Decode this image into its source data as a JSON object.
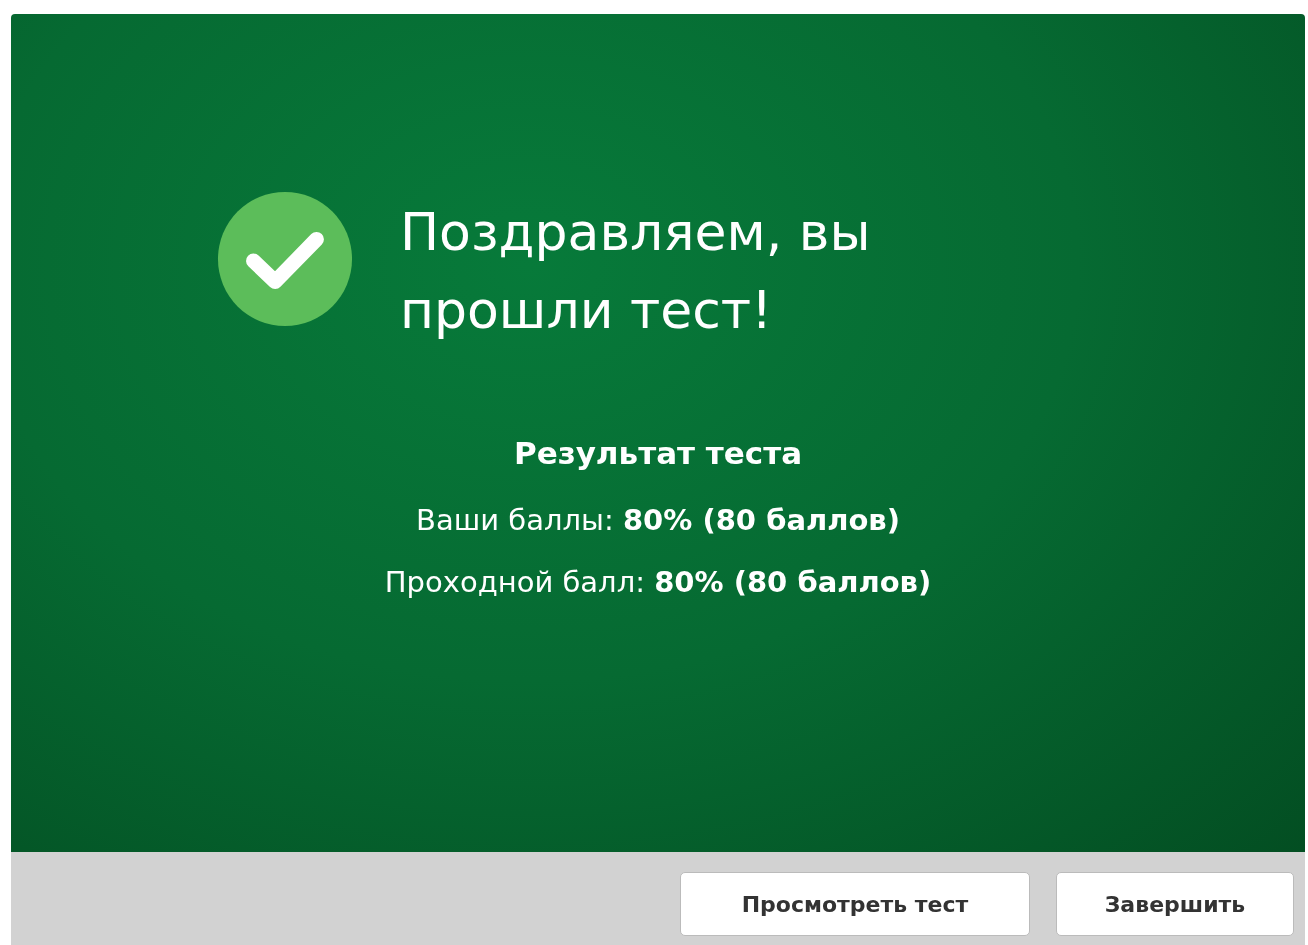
{
  "result": {
    "passed": true,
    "title": "Поздравляем, вы прошли тест!",
    "heading": "Результат теста",
    "lines": [
      "Ваши баллы: **80% (80 баллов)**",
      "Проходной балл: **80% (80 баллов)**"
    ]
  },
  "buttons": [
    {
      "label": "Просмотреть тест"
    },
    {
      "label": "Завершить"
    }
  ]
}
